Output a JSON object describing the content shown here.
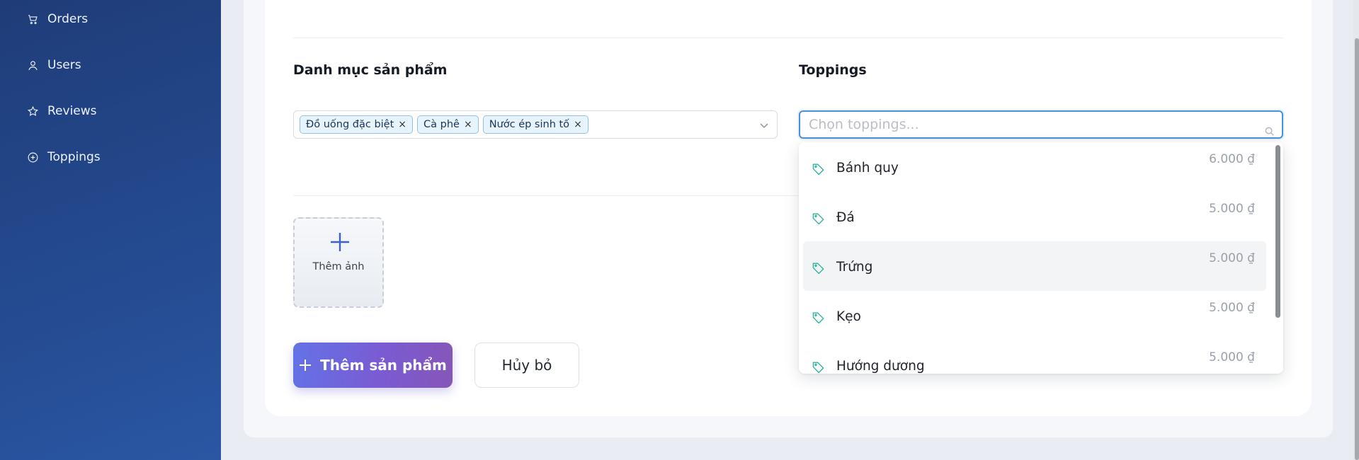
{
  "sidebar": {
    "items": [
      {
        "label": "Orders",
        "icon": "cart-icon"
      },
      {
        "label": "Users",
        "icon": "user-icon"
      },
      {
        "label": "Reviews",
        "icon": "star-icon"
      },
      {
        "label": "Toppings",
        "icon": "plus-circle-icon"
      }
    ]
  },
  "form": {
    "category": {
      "label": "Danh mục sản phẩm",
      "tags": [
        "Đồ uống đặc biệt",
        "Cà phê",
        "Nước ép sinh tố"
      ],
      "remove_glyph": "×"
    },
    "toppings": {
      "label": "Toppings",
      "placeholder": "Chọn toppings...",
      "value": "",
      "options": [
        {
          "name": "Bánh quy",
          "price": "6.000 ₫"
        },
        {
          "name": "Đá",
          "price": "5.000 ₫"
        },
        {
          "name": "Trứng",
          "price": "5.000 ₫"
        },
        {
          "name": "Kẹo",
          "price": "5.000 ₫"
        },
        {
          "name": "Hướng dương",
          "price": "5.000 ₫"
        }
      ],
      "highlighted_index": 2
    },
    "upload": {
      "label": "Thêm ảnh"
    },
    "actions": {
      "submit_label": "Thêm sản phẩm",
      "cancel_label": "Hủy bỏ"
    }
  },
  "colors": {
    "sidebar_bg": "#244a8f",
    "accent_blue": "#4a8fe0",
    "tag_border": "#8ac3f0",
    "tag_icon": "#2bb3a0",
    "submit_gradient_start": "#6373e6",
    "submit_gradient_end": "#8656b7"
  }
}
